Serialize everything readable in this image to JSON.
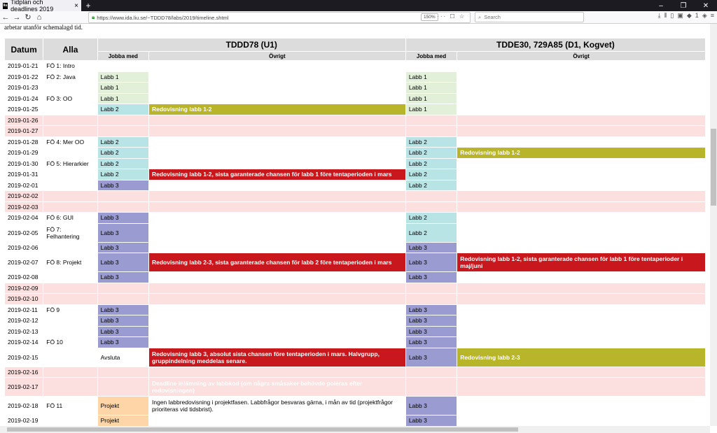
{
  "browser": {
    "tab_title": "Tidplan och deadlines 2019",
    "favicon_text": "liu",
    "url": "https://www.ida.liu.se/~TDDD78/labs/2019/timeline.shtml",
    "zoom": "150%",
    "search_placeholder": "Search"
  },
  "page": {
    "intro_text": "arbetar utanför schemalagd tid."
  },
  "table": {
    "headers": {
      "datum": "Datum",
      "alla": "Alla",
      "group1": "TDDD78 (U1)",
      "group2": "TDDE30, 729A85 (D1, Kogvet)",
      "jobba_med": "Jobba med",
      "ovrigt": "Övrigt"
    },
    "rows": [
      {
        "date": "2019-01-21",
        "alla": "FÖ 1: Intro",
        "j1": "",
        "j1c": "",
        "o1": "",
        "o1c": "",
        "j2": "",
        "j2c": "",
        "o2": "",
        "o2c": "",
        "weekend": false
      },
      {
        "date": "2019-01-22",
        "alla": "FÖ 2: Java",
        "j1": "Labb 1",
        "j1c": "green",
        "o1": "",
        "o1c": "",
        "j2": "Labb 1",
        "j2c": "green",
        "o2": "",
        "o2c": "",
        "weekend": false
      },
      {
        "date": "2019-01-23",
        "alla": "",
        "j1": "Labb 1",
        "j1c": "green",
        "o1": "",
        "o1c": "",
        "j2": "Labb 1",
        "j2c": "green",
        "o2": "",
        "o2c": "",
        "weekend": false
      },
      {
        "date": "2019-01-24",
        "alla": "FÖ 3: OO",
        "j1": "Labb 1",
        "j1c": "green",
        "o1": "",
        "o1c": "",
        "j2": "Labb 1",
        "j2c": "green",
        "o2": "",
        "o2c": "",
        "weekend": false
      },
      {
        "date": "2019-01-25",
        "alla": "",
        "j1": "Labb 2",
        "j1c": "cyan",
        "o1": "Redovisning labb 1-2",
        "o1c": "olive",
        "j2": "Labb 1",
        "j2c": "green",
        "o2": "",
        "o2c": "",
        "weekend": false
      },
      {
        "date": "2019-01-26",
        "alla": "",
        "j1": "",
        "j1c": "",
        "o1": "",
        "o1c": "",
        "j2": "",
        "j2c": "",
        "o2": "",
        "o2c": "",
        "weekend": true
      },
      {
        "date": "2019-01-27",
        "alla": "",
        "j1": "",
        "j1c": "",
        "o1": "",
        "o1c": "",
        "j2": "",
        "j2c": "",
        "o2": "",
        "o2c": "",
        "weekend": true
      },
      {
        "date": "2019-01-28",
        "alla": "FÖ 4: Mer OO",
        "j1": "Labb 2",
        "j1c": "cyan",
        "o1": "",
        "o1c": "",
        "j2": "Labb 2",
        "j2c": "cyan",
        "o2": "",
        "o2c": "",
        "weekend": false
      },
      {
        "date": "2019-01-29",
        "alla": "",
        "j1": "Labb 2",
        "j1c": "cyan",
        "o1": "",
        "o1c": "",
        "j2": "Labb 2",
        "j2c": "cyan",
        "o2": "Redovisning labb 1-2",
        "o2c": "olive",
        "weekend": false
      },
      {
        "date": "2019-01-30",
        "alla": "FÖ 5: Hierarkier",
        "j1": "Labb 2",
        "j1c": "cyan",
        "o1": "",
        "o1c": "",
        "j2": "Labb 2",
        "j2c": "cyan",
        "o2": "",
        "o2c": "",
        "weekend": false
      },
      {
        "date": "2019-01-31",
        "alla": "",
        "j1": "Labb 2",
        "j1c": "cyan",
        "o1": "Redovisning labb 1-2, sista garanterade chansen för labb 1 före tentaperioden i mars",
        "o1c": "red",
        "j2": "Labb 2",
        "j2c": "cyan",
        "o2": "",
        "o2c": "",
        "weekend": false
      },
      {
        "date": "2019-02-01",
        "alla": "",
        "j1": "Labb 3",
        "j1c": "purple",
        "o1": "",
        "o1c": "",
        "j2": "Labb 2",
        "j2c": "cyan",
        "o2": "",
        "o2c": "",
        "weekend": false
      },
      {
        "date": "2019-02-02",
        "alla": "",
        "j1": "",
        "j1c": "",
        "o1": "",
        "o1c": "",
        "j2": "",
        "j2c": "",
        "o2": "",
        "o2c": "",
        "weekend": true
      },
      {
        "date": "2019-02-03",
        "alla": "",
        "j1": "",
        "j1c": "",
        "o1": "",
        "o1c": "",
        "j2": "",
        "j2c": "",
        "o2": "",
        "o2c": "",
        "weekend": true
      },
      {
        "date": "2019-02-04",
        "alla": "FÖ 6: GUI",
        "j1": "Labb 3",
        "j1c": "purple",
        "o1": "",
        "o1c": "",
        "j2": "Labb 2",
        "j2c": "cyan",
        "o2": "",
        "o2c": "",
        "weekend": false
      },
      {
        "date": "2019-02-05",
        "alla": "FÖ 7: Felhantering",
        "j1": "Labb 3",
        "j1c": "purple",
        "o1": "",
        "o1c": "",
        "j2": "Labb 2",
        "j2c": "cyan",
        "o2": "",
        "o2c": "",
        "weekend": false,
        "tall": true
      },
      {
        "date": "2019-02-06",
        "alla": "",
        "j1": "Labb 3",
        "j1c": "purple",
        "o1": "",
        "o1c": "",
        "j2": "Labb 3",
        "j2c": "purple",
        "o2": "",
        "o2c": "",
        "weekend": false
      },
      {
        "date": "2019-02-07",
        "alla": "FÖ 8: Projekt",
        "j1": "Labb 3",
        "j1c": "purple",
        "o1": "Redovisning labb 2-3, sista garanterade chansen för labb 2 före tentaperioden i mars",
        "o1c": "red",
        "j2": "Labb 3",
        "j2c": "purple",
        "o2": "Redovisning labb 1-2, sista garanterade chansen för labb 1 före tentaperioder i maj/juni",
        "o2c": "red",
        "weekend": false,
        "tall": true
      },
      {
        "date": "2019-02-08",
        "alla": "",
        "j1": "Labb 3",
        "j1c": "purple",
        "o1": "",
        "o1c": "",
        "j2": "Labb 3",
        "j2c": "purple",
        "o2": "",
        "o2c": "",
        "weekend": false
      },
      {
        "date": "2019-02-09",
        "alla": "",
        "j1": "",
        "j1c": "",
        "o1": "",
        "o1c": "",
        "j2": "",
        "j2c": "",
        "o2": "",
        "o2c": "",
        "weekend": true
      },
      {
        "date": "2019-02-10",
        "alla": "",
        "j1": "",
        "j1c": "",
        "o1": "",
        "o1c": "",
        "j2": "",
        "j2c": "",
        "o2": "",
        "o2c": "",
        "weekend": true
      },
      {
        "date": "2019-02-11",
        "alla": "FÖ 9",
        "j1": "Labb 3",
        "j1c": "purple",
        "o1": "",
        "o1c": "",
        "j2": "Labb 3",
        "j2c": "purple",
        "o2": "",
        "o2c": "",
        "weekend": false
      },
      {
        "date": "2019-02-12",
        "alla": "",
        "j1": "Labb 3",
        "j1c": "purple",
        "o1": "",
        "o1c": "",
        "j2": "Labb 3",
        "j2c": "purple",
        "o2": "",
        "o2c": "",
        "weekend": false
      },
      {
        "date": "2019-02-13",
        "alla": "",
        "j1": "Labb 3",
        "j1c": "purple",
        "o1": "",
        "o1c": "",
        "j2": "Labb 3",
        "j2c": "purple",
        "o2": "",
        "o2c": "",
        "weekend": false
      },
      {
        "date": "2019-02-14",
        "alla": "FÖ 10",
        "j1": "Labb 3",
        "j1c": "purple",
        "o1": "",
        "o1c": "",
        "j2": "Labb 3",
        "j2c": "purple",
        "o2": "",
        "o2c": "",
        "weekend": false
      },
      {
        "date": "2019-02-15",
        "alla": "",
        "j1": "Avsluta",
        "j1c": "",
        "o1": "Redovisning labb 3, absolut sista chansen före tentaperioden i mars. Halvgrupp, gruppindelning meddelas senare.",
        "o1c": "red",
        "j2": "Labb 3",
        "j2c": "purple",
        "o2": "Redovisning labb 2-3",
        "o2c": "olive",
        "weekend": false,
        "tall": true
      },
      {
        "date": "2019-02-16",
        "alla": "",
        "j1": "",
        "j1c": "",
        "o1": "",
        "o1c": "",
        "j2": "",
        "j2c": "",
        "o2": "",
        "o2c": "",
        "weekend": true
      },
      {
        "date": "2019-02-17",
        "alla": "",
        "j1": "",
        "j1c": "",
        "o1": "Deadline inlämning av labbkod (om några småsaker behövde poleras efter redovisningen)",
        "o1c": "red",
        "j2": "",
        "j2c": "",
        "o2": "",
        "o2c": "",
        "weekend": true,
        "tall": true
      },
      {
        "date": "2019-02-18",
        "alla": "FÖ 11",
        "j1": "Projekt",
        "j1c": "orange",
        "o1": "Ingen labbredovisning i projektfasen. Labbfrågor besvaras gärna, i mån av tid (projektfrågor prioriteras vid tidsbrist).",
        "o1c": "",
        "j2": "Labb 3",
        "j2c": "purple",
        "o2": "",
        "o2c": "",
        "weekend": false,
        "tall": true
      },
      {
        "date": "2019-02-19",
        "alla": "",
        "j1": "Projekt",
        "j1c": "orange",
        "o1": "",
        "o1c": "",
        "j2": "Labb 3",
        "j2c": "purple",
        "o2": "",
        "o2c": "",
        "weekend": false
      }
    ]
  }
}
